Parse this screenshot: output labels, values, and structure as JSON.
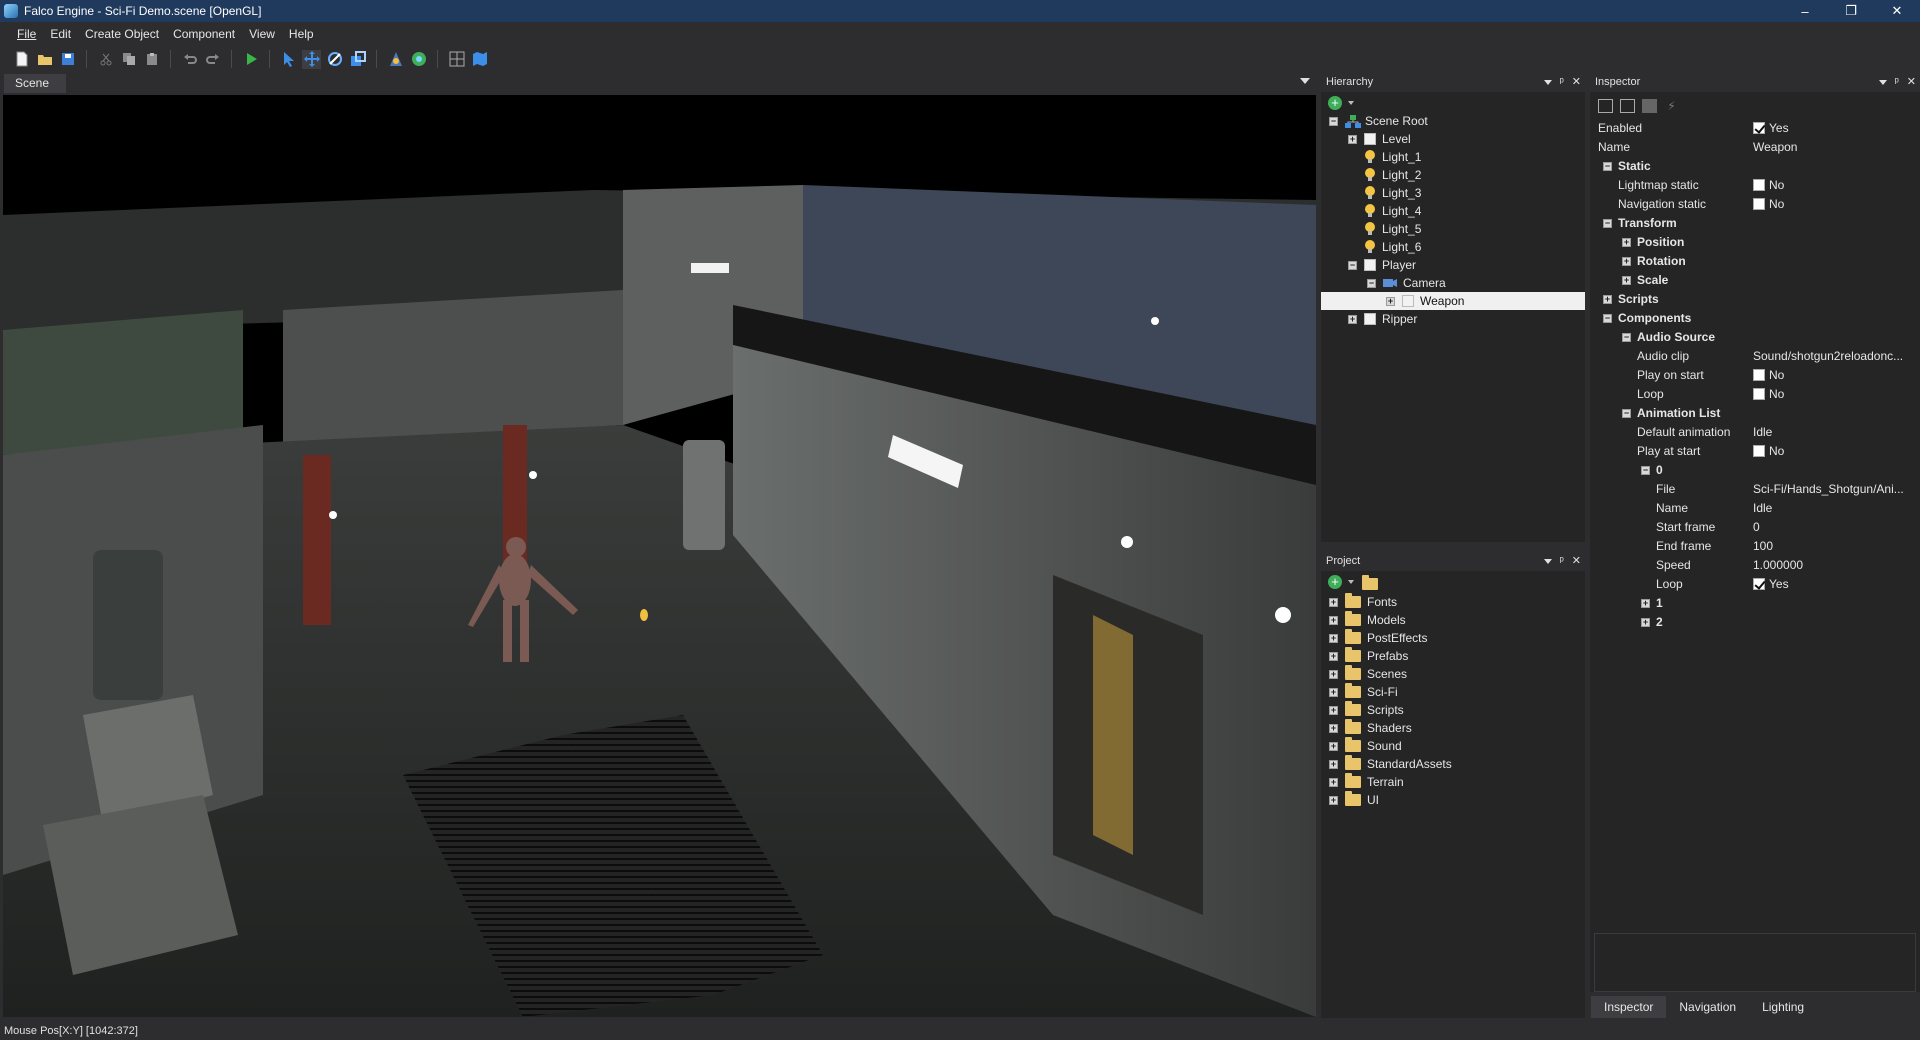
{
  "window": {
    "title": "Falco Engine - Sci-Fi Demo.scene [OpenGL]",
    "controls": [
      "–",
      "❐",
      "✕"
    ]
  },
  "menu": [
    "File",
    "Edit",
    "Create Object",
    "Component",
    "View",
    "Help"
  ],
  "toolbar": {
    "icons": [
      "new-file-icon",
      "open-folder-icon",
      "save-icon",
      "cut-icon",
      "copy-icon",
      "paste-icon",
      "undo-icon",
      "redo-icon",
      "play-icon",
      "select-tool-icon",
      "move-tool-icon",
      "rotate-tool-icon",
      "scale-tool-icon",
      "lightmap-icon",
      "navmesh-icon",
      "grid-icon",
      "map-icon"
    ]
  },
  "scene": {
    "tab_label": "Scene"
  },
  "hierarchy": {
    "title": "Hierarchy",
    "items": [
      {
        "label": "Scene Root",
        "depth": 0,
        "expander": "−",
        "icon": "scene-root"
      },
      {
        "label": "Level",
        "depth": 1,
        "expander": "+",
        "icon": "object"
      },
      {
        "label": "Light_1",
        "depth": 1,
        "expander": "",
        "icon": "light"
      },
      {
        "label": "Light_2",
        "depth": 1,
        "expander": "",
        "icon": "light"
      },
      {
        "label": "Light_3",
        "depth": 1,
        "expander": "",
        "icon": "light"
      },
      {
        "label": "Light_4",
        "depth": 1,
        "expander": "",
        "icon": "light"
      },
      {
        "label": "Light_5",
        "depth": 1,
        "expander": "",
        "icon": "light"
      },
      {
        "label": "Light_6",
        "depth": 1,
        "expander": "",
        "icon": "light"
      },
      {
        "label": "Player",
        "depth": 1,
        "expander": "−",
        "icon": "object"
      },
      {
        "label": "Camera",
        "depth": 2,
        "expander": "−",
        "icon": "camera"
      },
      {
        "label": "Weapon",
        "depth": 3,
        "expander": "+",
        "icon": "object",
        "selected": true
      },
      {
        "label": "Ripper",
        "depth": 1,
        "expander": "+",
        "icon": "object"
      }
    ]
  },
  "project": {
    "title": "Project",
    "folders": [
      "Fonts",
      "Models",
      "PostEffects",
      "Prefabs",
      "Scenes",
      "Sci-Fi",
      "Scripts",
      "Shaders",
      "Sound",
      "StandardAssets",
      "Terrain",
      "UI"
    ]
  },
  "inspector": {
    "title": "Inspector",
    "rows": [
      {
        "label": "Enabled",
        "value": "Yes",
        "check": true,
        "indent": 0
      },
      {
        "label": "Name",
        "value": "Weapon",
        "indent": 0
      },
      {
        "label": "Static",
        "head": true,
        "exp": "−",
        "indent": 0
      },
      {
        "label": "Lightmap static",
        "value": "No",
        "check": false,
        "indent": 1
      },
      {
        "label": "Navigation static",
        "value": "No",
        "check": false,
        "indent": 1
      },
      {
        "label": "Transform",
        "head": true,
        "exp": "−",
        "indent": 0
      },
      {
        "label": "Position",
        "head": true,
        "exp": "+",
        "indent": 1
      },
      {
        "label": "Rotation",
        "head": true,
        "exp": "+",
        "indent": 1
      },
      {
        "label": "Scale",
        "head": true,
        "exp": "+",
        "indent": 1
      },
      {
        "label": "Scripts",
        "head": true,
        "exp": "+",
        "indent": 0
      },
      {
        "label": "Components",
        "head": true,
        "exp": "−",
        "indent": 0
      },
      {
        "label": "Audio Source",
        "head": true,
        "exp": "−",
        "indent": 1
      },
      {
        "label": "Audio clip",
        "value": "Sound/shotgun2reloadonc...",
        "indent": 2
      },
      {
        "label": "Play on start",
        "value": "No",
        "check": false,
        "indent": 2
      },
      {
        "label": "Loop",
        "value": "No",
        "check": false,
        "indent": 2
      },
      {
        "label": "Animation List",
        "head": true,
        "exp": "−",
        "indent": 1
      },
      {
        "label": "Default animation",
        "value": "Idle",
        "indent": 2
      },
      {
        "label": "Play at start",
        "value": "No",
        "check": false,
        "indent": 2
      },
      {
        "label": "0",
        "head": true,
        "exp": "−",
        "indent": 2
      },
      {
        "label": "File",
        "value": "Sci-Fi/Hands_Shotgun/Ani...",
        "indent": 3
      },
      {
        "label": "Name",
        "value": "Idle",
        "indent": 3
      },
      {
        "label": "Start frame",
        "value": "0",
        "indent": 3
      },
      {
        "label": "End frame",
        "value": "100",
        "indent": 3
      },
      {
        "label": "Speed",
        "value": "1.000000",
        "indent": 3
      },
      {
        "label": "Loop",
        "value": "Yes",
        "check": true,
        "indent": 3
      },
      {
        "label": "1",
        "head": true,
        "exp": "+",
        "indent": 2
      },
      {
        "label": "2",
        "head": true,
        "exp": "+",
        "indent": 2
      }
    ],
    "bottom_tabs": [
      "Inspector",
      "Navigation",
      "Lighting"
    ]
  },
  "status": {
    "text": "Mouse Pos[X:Y] [1042:372]"
  }
}
